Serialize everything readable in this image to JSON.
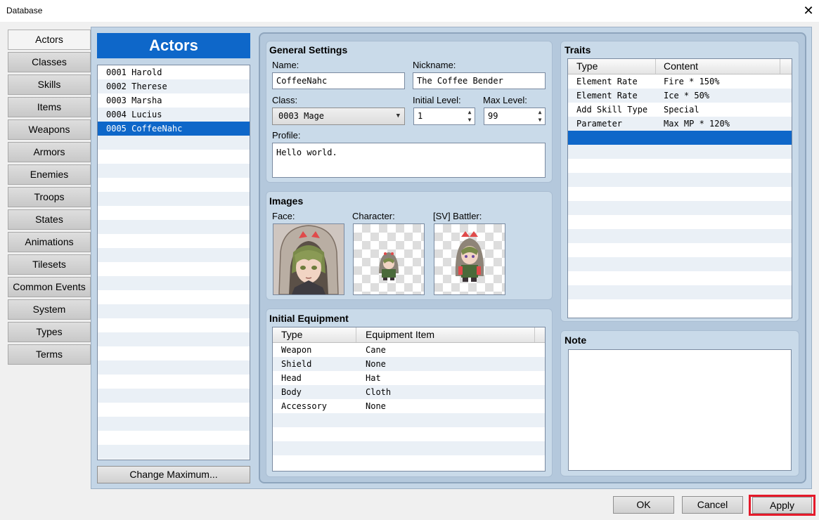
{
  "window": {
    "title": "Database",
    "close_glyph": "✕"
  },
  "sidebar": {
    "items": [
      "Actors",
      "Classes",
      "Skills",
      "Items",
      "Weapons",
      "Armors",
      "Enemies",
      "Troops",
      "States",
      "Animations",
      "Tilesets",
      "Common Events",
      "System",
      "Types",
      "Terms"
    ],
    "active": "Actors"
  },
  "actors": {
    "header": "Actors",
    "list": [
      "0001 Harold",
      "0002 Therese",
      "0003 Marsha",
      "0004 Lucius",
      "0005 CoffeeNahc"
    ],
    "selected_index": 4,
    "change_max_label": "Change Maximum..."
  },
  "general": {
    "title": "General Settings",
    "name_label": "Name:",
    "name_value": "CoffeeNahc",
    "nickname_label": "Nickname:",
    "nickname_value": "The Coffee Bender",
    "class_label": "Class:",
    "class_value": "0003 Mage",
    "initial_level_label": "Initial Level:",
    "initial_level_value": "1",
    "max_level_label": "Max Level:",
    "max_level_value": "99",
    "profile_label": "Profile:",
    "profile_value": "Hello world."
  },
  "images": {
    "title": "Images",
    "face_label": "Face:",
    "character_label": "Character:",
    "battler_label": "[SV] Battler:"
  },
  "equipment": {
    "title": "Initial Equipment",
    "col_type": "Type",
    "col_item": "Equipment Item",
    "rows": [
      {
        "type": "Weapon",
        "item": "Cane"
      },
      {
        "type": "Shield",
        "item": "None"
      },
      {
        "type": "Head",
        "item": "Hat"
      },
      {
        "type": "Body",
        "item": "Cloth"
      },
      {
        "type": "Accessory",
        "item": "None"
      }
    ]
  },
  "traits": {
    "title": "Traits",
    "col_type": "Type",
    "col_content": "Content",
    "rows": [
      {
        "type": "Element Rate",
        "content": "Fire * 150%"
      },
      {
        "type": "Element Rate",
        "content": "Ice * 50%"
      },
      {
        "type": "Add Skill Type",
        "content": "Special"
      },
      {
        "type": "Parameter",
        "content": "Max MP * 120%"
      }
    ]
  },
  "note": {
    "title": "Note",
    "value": ""
  },
  "footer": {
    "ok": "OK",
    "cancel": "Cancel",
    "apply": "Apply"
  },
  "colors": {
    "accent": "#0e67c9",
    "panel": "#c3d5e6",
    "highlight": "#e51a2a"
  }
}
